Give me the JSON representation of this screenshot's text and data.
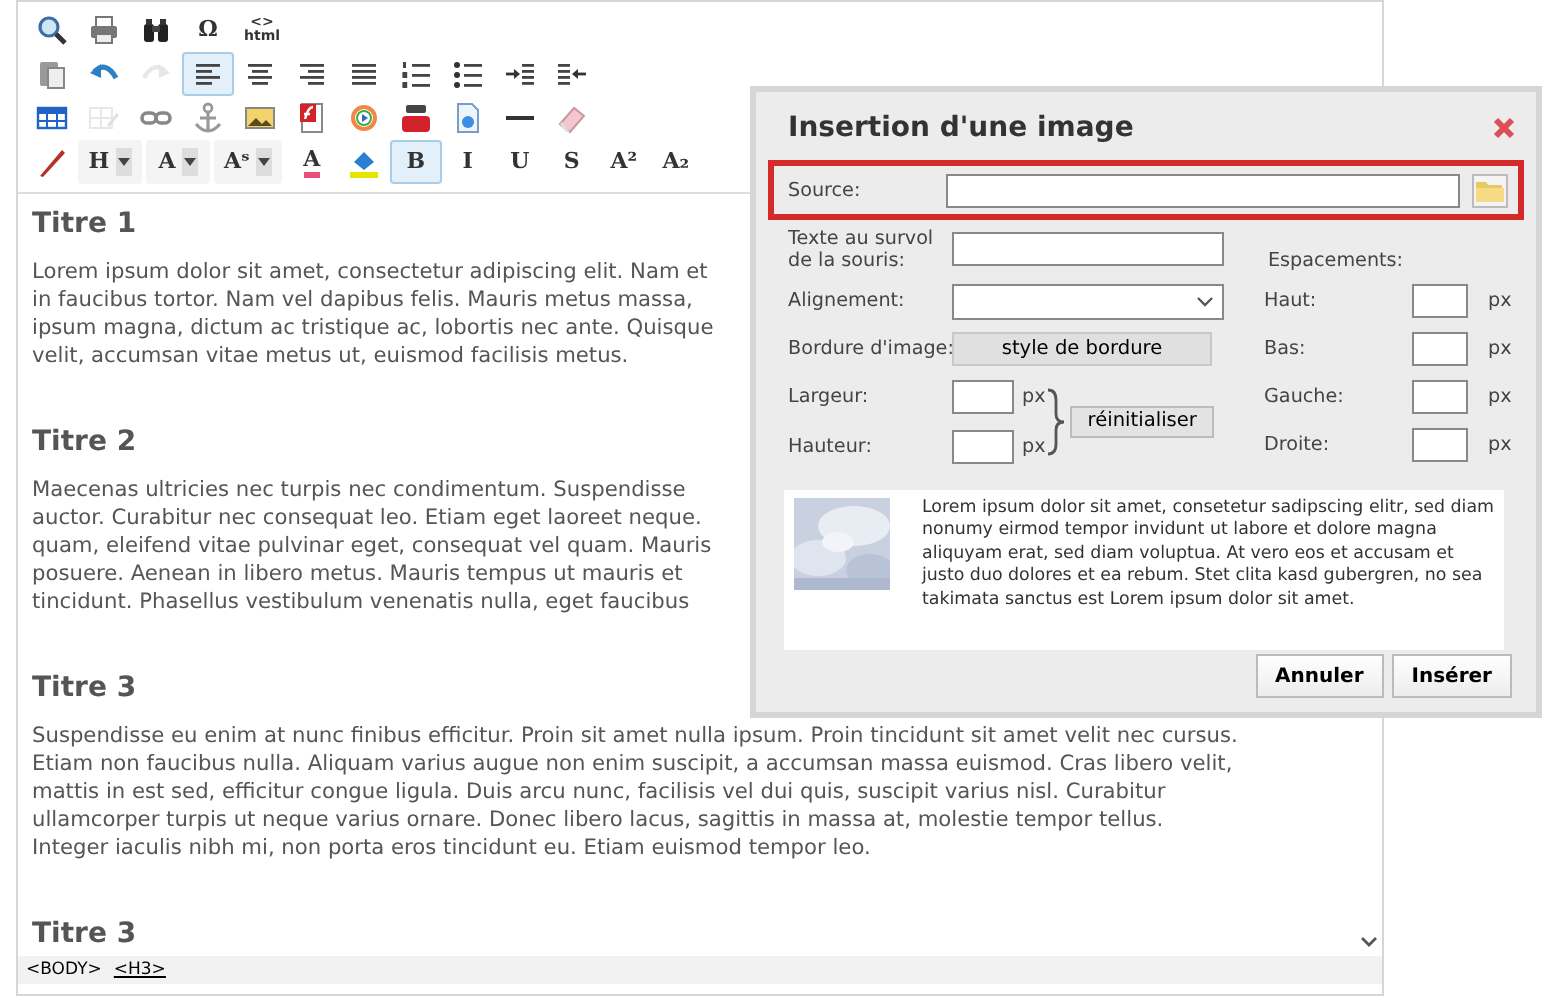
{
  "toolbar": [
    {
      "items": [
        {
          "kind": "icon",
          "selected": false,
          "disabled": false
        },
        {
          "kind": "icon",
          "selected": false,
          "disabled": false
        },
        {
          "kind": "icon",
          "selected": false,
          "disabled": false
        },
        {
          "kind": "glyph",
          "label": "Ω",
          "selected": false,
          "disabled": false
        },
        {
          "kind": "stack",
          "label": "<>",
          "sublabel": "html",
          "selected": false,
          "disabled": false
        }
      ]
    },
    {
      "items": [
        {
          "kind": "icon",
          "selected": false,
          "disabled": false
        },
        {
          "kind": "icon",
          "selected": false,
          "disabled": false
        },
        {
          "kind": "icon",
          "selected": false,
          "disabled": true
        },
        {
          "kind": "icon",
          "selected": true,
          "disabled": false
        },
        {
          "kind": "icon",
          "selected": false,
          "disabled": false
        },
        {
          "kind": "icon",
          "selected": false,
          "disabled": false
        },
        {
          "kind": "icon",
          "selected": false,
          "disabled": false
        },
        {
          "kind": "icon",
          "selected": false,
          "disabled": false
        },
        {
          "kind": "icon",
          "selected": false,
          "disabled": false
        },
        {
          "kind": "icon",
          "selected": false,
          "disabled": false
        },
        {
          "kind": "icon",
          "selected": false,
          "disabled": false
        }
      ]
    },
    {
      "items": [
        {
          "kind": "icon",
          "selected": false,
          "disabled": false
        },
        {
          "kind": "icon",
          "selected": false,
          "disabled": true
        },
        {
          "kind": "icon",
          "selected": false,
          "disabled": false
        },
        {
          "kind": "icon",
          "selected": false,
          "disabled": false
        },
        {
          "kind": "icon",
          "selected": false,
          "disabled": false
        },
        {
          "kind": "icon",
          "selected": false,
          "disabled": false
        },
        {
          "kind": "icon",
          "selected": false,
          "disabled": false
        },
        {
          "kind": "icon",
          "selected": false,
          "disabled": false
        },
        {
          "kind": "icon",
          "selected": false,
          "disabled": false
        },
        {
          "kind": "icon",
          "selected": false,
          "disabled": false
        },
        {
          "kind": "icon",
          "selected": false,
          "disabled": false
        }
      ]
    },
    {
      "items": [
        {
          "kind": "icon",
          "selected": false,
          "disabled": false
        },
        {
          "kind": "dropdown",
          "label": "H",
          "selected": false,
          "disabled": false
        },
        {
          "kind": "dropdown",
          "label": "A",
          "selected": false,
          "disabled": false
        },
        {
          "kind": "dropdown",
          "label": "Aˢ",
          "selected": false,
          "disabled": false
        },
        {
          "kind": "color",
          "label": "A",
          "color": "#e8507a",
          "selected": false,
          "disabled": false
        },
        {
          "kind": "icon",
          "selected": false,
          "disabled": false
        },
        {
          "kind": "glyph",
          "label": "B",
          "selected": true,
          "disabled": false
        },
        {
          "kind": "glyph",
          "label": "I",
          "selected": false,
          "disabled": false
        },
        {
          "kind": "glyph",
          "label": "U",
          "selected": false,
          "disabled": false
        },
        {
          "kind": "glyph",
          "label": "S",
          "selected": false,
          "disabled": false
        },
        {
          "kind": "glyph",
          "label": "A²",
          "selected": false,
          "disabled": false
        },
        {
          "kind": "glyph",
          "label": "A₂",
          "selected": false,
          "disabled": false
        }
      ]
    }
  ],
  "document": [
    {
      "kind": "heading",
      "text": "Titre 1"
    },
    {
      "kind": "paragraph",
      "lines": [
        "Lorem ipsum dolor sit amet, consectetur adipiscing elit. Nam et",
        "in faucibus tortor. Nam vel dapibus felis. Mauris metus massa,",
        "ipsum magna, dictum ac tristique ac, lobortis nec ante. Quisque",
        "velit, accumsan vitae metus ut, euismod facilisis metus."
      ]
    },
    {
      "kind": "heading",
      "text": "Titre 2"
    },
    {
      "kind": "paragraph",
      "lines": [
        "Maecenas ultricies nec turpis nec condimentum. Suspendisse",
        "auctor. Curabitur nec consequat leo. Etiam eget laoreet neque.",
        "quam, eleifend vitae pulvinar eget, consequat vel quam. Mauris",
        "posuere. Aenean in libero metus. Mauris tempus ut mauris et",
        "tincidunt. Phasellus vestibulum venenatis nulla, eget faucibus"
      ]
    },
    {
      "kind": "heading",
      "text": "Titre 3"
    },
    {
      "kind": "paragraph",
      "lines": [
        "Suspendisse eu enim at nunc finibus efficitur. Proin sit amet nulla ipsum. Proin tincidunt sit amet velit nec cursus.",
        "Etiam non faucibus nulla. Aliquam varius augue non enim suscipit, a accumsan massa euismod. Cras libero velit,",
        "mattis in est sed, efficitur congue ligula. Duis arcu nunc, facilisis vel dui quis, suscipit varius nisl. Curabitur",
        "ullamcorper turpis ut neque varius ornare. Donec libero lacus, sagittis in massa at, molestie tempor tellus.",
        "Integer iaculis nibh mi, non porta eros tincidunt eu. Etiam euismod tempor leo."
      ]
    },
    {
      "kind": "heading",
      "text": "Titre 3"
    }
  ],
  "status_bar": {
    "path": [
      {
        "tag": "<BODY>",
        "selected": false
      },
      {
        "tag": "<H3>",
        "selected": true
      }
    ]
  },
  "dialog": {
    "title": "Insertion d'une image",
    "source": {
      "label": "Source:",
      "highlighted": true
    },
    "hover_text": {
      "label": "Texte au survol de la souris:"
    },
    "alignment": {
      "label": "Alignement:"
    },
    "border": {
      "label": "Bordure d'image:",
      "button": "style de bordure"
    },
    "width": {
      "label": "Largeur:",
      "unit": "px"
    },
    "height": {
      "label": "Hauteur:",
      "unit": "px"
    },
    "reset_button": "réinitialiser",
    "spacing": {
      "label": "Espacements:",
      "fields": [
        {
          "label": "Haut:",
          "unit": "px"
        },
        {
          "label": "Bas:",
          "unit": "px"
        },
        {
          "label": "Gauche:",
          "unit": "px"
        },
        {
          "label": "Droite:",
          "unit": "px"
        }
      ]
    },
    "preview_text": "Lorem ipsum dolor sit amet, consetetur sadipscing elitr, sed diam nonumy eirmod tempor invidunt ut labore et dolore magna aliquyam erat, sed diam voluptua. At vero eos et accusam et justo duo dolores et ea rebum. Stet clita kasd gubergren, no sea takimata sanctus est Lorem ipsum dolor sit amet.",
    "buttons": [
      "Annuler",
      "Insérer"
    ]
  }
}
